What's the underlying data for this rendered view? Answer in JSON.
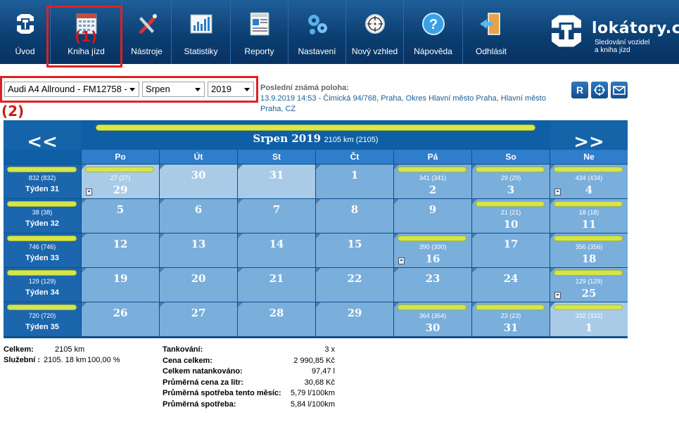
{
  "nav": {
    "items": [
      {
        "label": "Úvod",
        "icon": "logo-home-icon"
      },
      {
        "label": "Kniha jízd",
        "icon": "calendar-icon"
      },
      {
        "label": "Nástroje",
        "icon": "tools-icon"
      },
      {
        "label": "Statistiky",
        "icon": "chart-icon"
      },
      {
        "label": "Reporty",
        "icon": "report-icon"
      },
      {
        "label": "Nastavení",
        "icon": "gears-icon"
      },
      {
        "label": "Nový vzhled",
        "icon": "crosshair-icon"
      },
      {
        "label": "Nápověda",
        "icon": "help-icon"
      },
      {
        "label": "Odhlásit",
        "icon": "logout-door-icon"
      }
    ],
    "brand_name": "lokátory.cz",
    "brand_sub_1": "Sledování vozidel",
    "brand_sub_2": "a kniha jízd"
  },
  "annotations": {
    "one": "(1)",
    "two": "(2)"
  },
  "filters": {
    "vehicle": "Audi A4 Allround - FM12758 -",
    "month": "Srpen",
    "year": "2019"
  },
  "last_position": {
    "title": "Poslední známá poloha:",
    "text": "13.9.2019 14:53 - Čimická 94/768, Praha, Okres Hlavní město Praha, Hlavní město Praha, CZ"
  },
  "actions": {
    "r_label": "R",
    "locate_icon": "target-icon",
    "mail_icon": "mail-icon"
  },
  "calendar": {
    "prev": "<<",
    "next": ">>",
    "month_title": "Srpen 2019",
    "month_km": "2105 km (2105)",
    "days": [
      "Po",
      "Út",
      "St",
      "Čt",
      "Pá",
      "So",
      "Ne"
    ],
    "weeks": [
      {
        "week": "Týden 31",
        "km": "832 (832)",
        "cells": [
          {
            "d": "29",
            "km": "27 (27)",
            "fuel": true,
            "other": true
          },
          {
            "d": "30",
            "km": "",
            "other": true
          },
          {
            "d": "31",
            "km": "",
            "other": true
          },
          {
            "d": "1",
            "km": ""
          },
          {
            "d": "2",
            "km": "341 (341)"
          },
          {
            "d": "3",
            "km": "29 (29)"
          },
          {
            "d": "4",
            "km": "434 (434)",
            "fuel": true
          }
        ]
      },
      {
        "week": "Týden 32",
        "km": "38 (38)",
        "cells": [
          {
            "d": "5",
            "km": ""
          },
          {
            "d": "6",
            "km": ""
          },
          {
            "d": "7",
            "km": ""
          },
          {
            "d": "8",
            "km": ""
          },
          {
            "d": "9",
            "km": ""
          },
          {
            "d": "10",
            "km": "21 (21)"
          },
          {
            "d": "11",
            "km": "18 (18)"
          }
        ]
      },
      {
        "week": "Týden 33",
        "km": "746 (746)",
        "cells": [
          {
            "d": "12",
            "km": ""
          },
          {
            "d": "13",
            "km": ""
          },
          {
            "d": "14",
            "km": ""
          },
          {
            "d": "15",
            "km": ""
          },
          {
            "d": "16",
            "km": "390 (390)",
            "fuel": true
          },
          {
            "d": "17",
            "km": ""
          },
          {
            "d": "18",
            "km": "356 (356)"
          }
        ]
      },
      {
        "week": "Týden 34",
        "km": "129 (129)",
        "cells": [
          {
            "d": "19",
            "km": ""
          },
          {
            "d": "20",
            "km": ""
          },
          {
            "d": "21",
            "km": ""
          },
          {
            "d": "22",
            "km": ""
          },
          {
            "d": "23",
            "km": ""
          },
          {
            "d": "24",
            "km": ""
          },
          {
            "d": "25",
            "km": "129 (129)",
            "fuel": true
          }
        ]
      },
      {
        "week": "Týden 35",
        "km": "720 (720)",
        "cells": [
          {
            "d": "26",
            "km": ""
          },
          {
            "d": "27",
            "km": ""
          },
          {
            "d": "28",
            "km": ""
          },
          {
            "d": "29",
            "km": ""
          },
          {
            "d": "30",
            "km": "364 (364)"
          },
          {
            "d": "31",
            "km": "23 (23)"
          },
          {
            "d": "1",
            "km": "332 (332)",
            "other": true
          }
        ]
      }
    ]
  },
  "summary_left": {
    "total_label": "Celkem:",
    "total_value": "2105 km",
    "business_label": "Služební :",
    "business_value": "2105. 18 km",
    "business_pct": "100,00 %"
  },
  "summary_right": [
    {
      "k": "Tankování:",
      "v": "3 x"
    },
    {
      "k": "Cena celkem:",
      "v": "2 990,85 Kč"
    },
    {
      "k": "Celkem natankováno:",
      "v": "97,47 l"
    },
    {
      "k": "Průměrná cena za litr:",
      "v": "30,68 Kč"
    },
    {
      "k": "Průměrná spotřeba tento měsíc:",
      "v": "5,79 l/100km"
    },
    {
      "k": "Průměrná spotřeba:",
      "v": "5,84 l/100km"
    }
  ]
}
